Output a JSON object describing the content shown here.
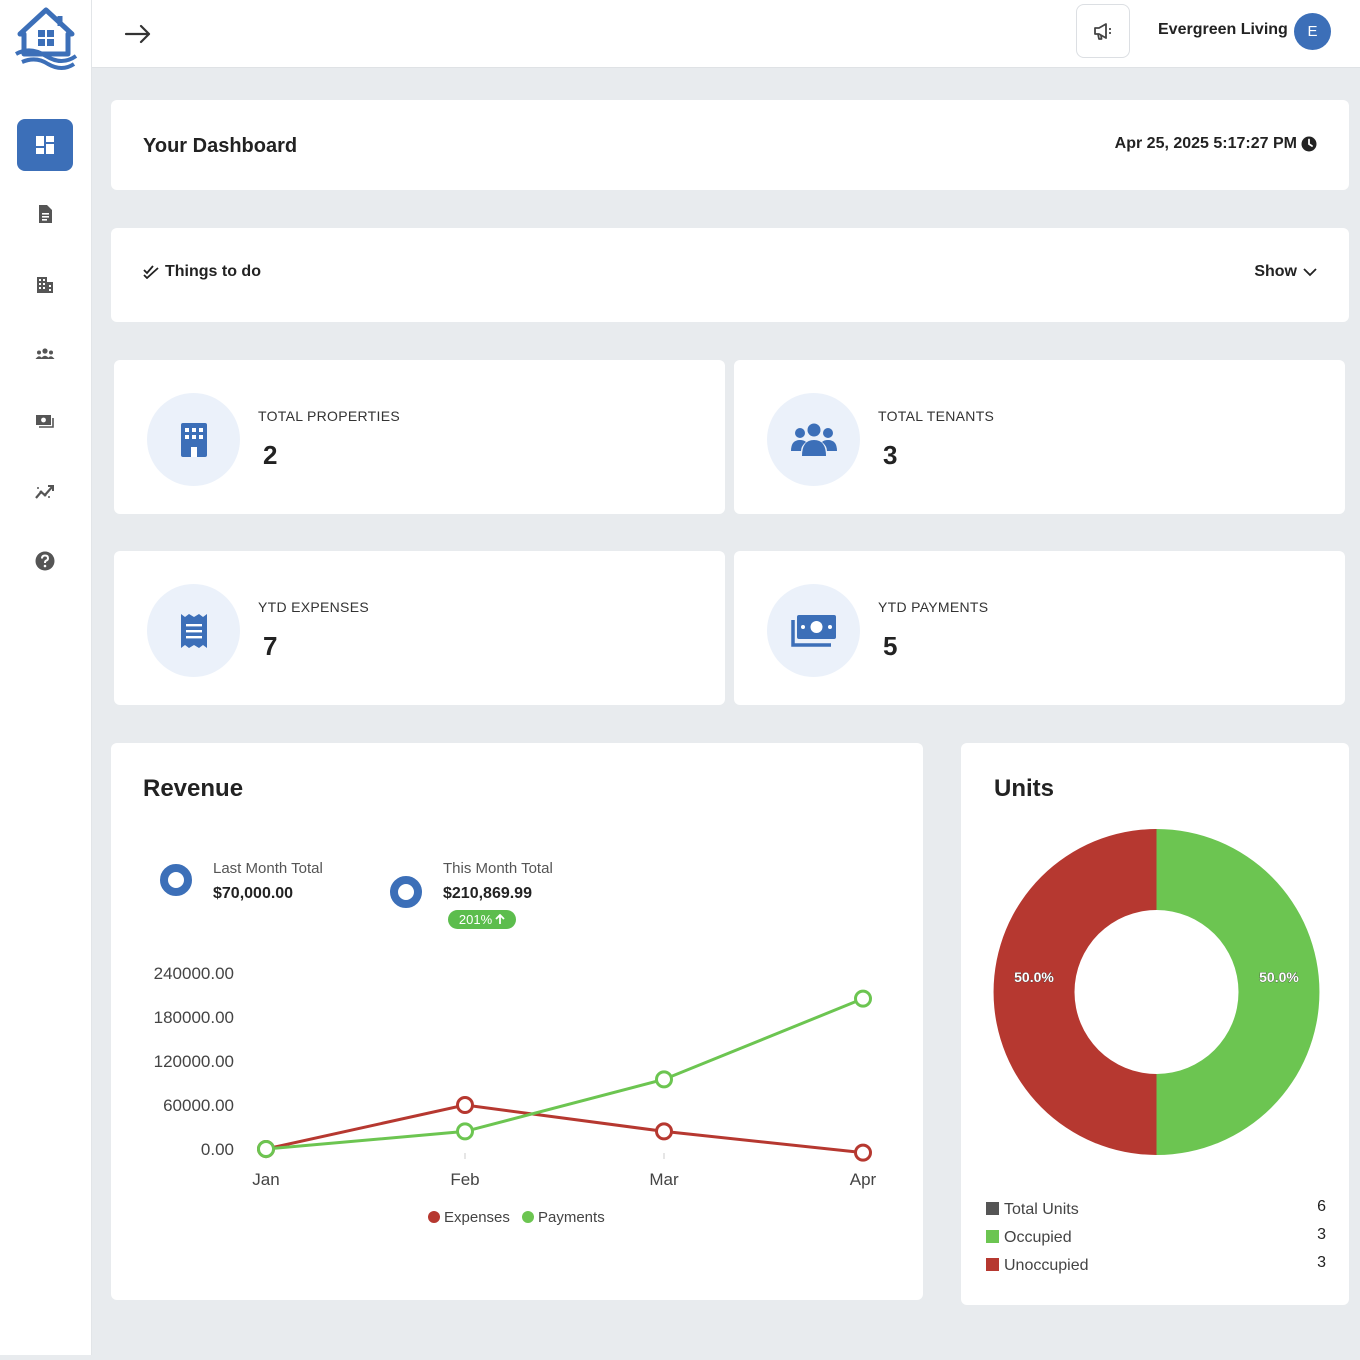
{
  "header": {
    "org_name": "Evergreen Living",
    "avatar_initial": "E"
  },
  "sidebar": {
    "items": [
      {
        "name": "dashboard",
        "icon": "dashboard-icon",
        "active": true
      },
      {
        "name": "documents",
        "icon": "document-icon"
      },
      {
        "name": "properties",
        "icon": "building-icon"
      },
      {
        "name": "tenants",
        "icon": "people-icon"
      },
      {
        "name": "payments",
        "icon": "money-icon"
      },
      {
        "name": "reports",
        "icon": "chart-trend-icon"
      },
      {
        "name": "help",
        "icon": "help-icon"
      }
    ]
  },
  "dashboard": {
    "title": "Your Dashboard",
    "datetime": "Apr 25, 2025 5:17:27 PM"
  },
  "todo": {
    "label": "Things to do",
    "toggle": "Show"
  },
  "stats": [
    {
      "label": "TOTAL PROPERTIES",
      "value": "2",
      "icon": "building-icon"
    },
    {
      "label": "TOTAL TENANTS",
      "value": "3",
      "icon": "people-icon"
    },
    {
      "label": "YTD EXPENSES",
      "value": "7",
      "icon": "receipt-icon"
    },
    {
      "label": "YTD PAYMENTS",
      "value": "5",
      "icon": "money-icon"
    }
  ],
  "revenue": {
    "title": "Revenue",
    "last_month_label": "Last Month Total",
    "last_month_value": "$70,000.00",
    "this_month_label": "This Month Total",
    "this_month_value": "$210,869.99",
    "change_badge": "201%"
  },
  "units": {
    "title": "Units",
    "legend": [
      {
        "label": "Total Units",
        "count": "6",
        "color": "#555555"
      },
      {
        "label": "Occupied",
        "count": "3",
        "color": "#6cc551"
      },
      {
        "label": "Unoccupied",
        "count": "3",
        "color": "#b63830"
      }
    ]
  },
  "colors": {
    "accent": "#3c6fb8",
    "payments": "#6cc551",
    "expenses": "#b63830"
  },
  "chart_data": [
    {
      "type": "line",
      "categories": [
        "Jan",
        "Feb",
        "Mar",
        "Apr"
      ],
      "y_ticks": [
        "240000.00",
        "180000.00",
        "120000.00",
        "60000.00",
        "0.00"
      ],
      "ylim": [
        0,
        240000
      ],
      "series": [
        {
          "name": "Expenses",
          "color": "#b63830",
          "values": [
            0,
            60000,
            24000,
            -5000
          ]
        },
        {
          "name": "Payments",
          "color": "#6cc551",
          "values": [
            0,
            24000,
            95000,
            205000
          ]
        }
      ],
      "legend": "bottom"
    },
    {
      "type": "pie",
      "donut": true,
      "slices": [
        {
          "name": "Occupied",
          "value": 50.0,
          "label": "50.0%",
          "color": "#6cc551"
        },
        {
          "name": "Unoccupied",
          "value": 50.0,
          "label": "50.0%",
          "color": "#b63830"
        }
      ]
    }
  ]
}
